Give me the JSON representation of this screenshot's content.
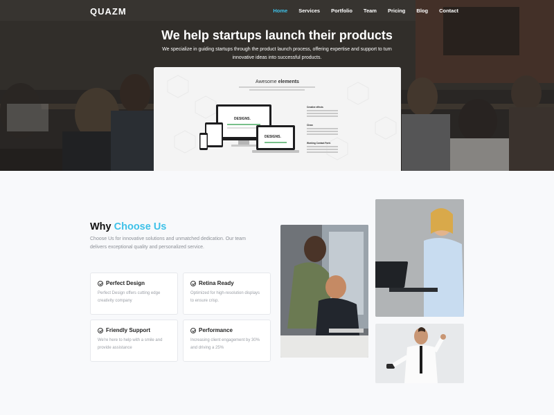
{
  "nav": {
    "logo": "QUAZM",
    "items": [
      "Home",
      "Services",
      "Portfolio",
      "Team",
      "Pricing",
      "Blog",
      "Contact"
    ],
    "active": "Home"
  },
  "hero": {
    "title": "We help startups launch their products",
    "subtitle": "We specialize in guiding startups through the product launch process, offering expertise and support to turn innovative ideas into successful products."
  },
  "showcase": {
    "title_plain": "Awesome",
    "title_bold": "elements",
    "device_text": "DESIGNS.",
    "features": [
      "Creative effects",
      "Clean",
      "Working Contact Form"
    ]
  },
  "why": {
    "title_plain": "Why",
    "title_accent": "Choose Us",
    "description": "Choose Us for innovative solutions and unmatched dedication. Our team delivers exceptional quality and personalized service.",
    "cards": [
      {
        "title": "Perfect Design",
        "text": "Perfect Design offers cutting edge creativity company"
      },
      {
        "title": "Retina Ready",
        "text": "Optimized for high-resolution displays to ensure crisp."
      },
      {
        "title": "Friendly Support",
        "text": "We're here to help with a smile and provide assistance"
      },
      {
        "title": "Performance",
        "text": "Increasing client engagement by 30% and driving a 25%"
      }
    ]
  },
  "colors": {
    "accent": "#3ec1e8",
    "hero_overlay": "#2c2a28",
    "page_bg": "#f8f9fb"
  }
}
